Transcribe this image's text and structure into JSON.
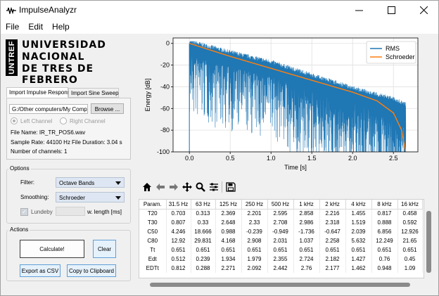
{
  "window": {
    "title": "ImpulseAnalyzr"
  },
  "menu": [
    "File",
    "Edit",
    "Help"
  ],
  "logo": {
    "side": "UNTREF",
    "lines": [
      "UNIVERSIDAD",
      "NACIONAL",
      "DE TRES DE FEBRERO"
    ]
  },
  "tabs": [
    "Import Impulse Response",
    "Import Sine Sweep"
  ],
  "import": {
    "path_value": "G:/Other computers/My Comp",
    "browse_label": "Browse ...",
    "left_channel": "Left Channel",
    "right_channel": "Right Channel",
    "file_name": "File Name: IR_TR_POS6.wav",
    "sample_rate": "Sample Rate: 44100 Hz",
    "duration": "File Duration: 3.04 s",
    "channels": "Number of channels: 1"
  },
  "options": {
    "title": "Options",
    "filter_label": "Filter:",
    "filter_value": "Octave Bands",
    "smoothing_label": "Smoothing:",
    "smoothing_value": "Schroeder",
    "lundeby_label": "Lundeby",
    "lundeby_checked": true,
    "wlength_label": "w. length [ms]"
  },
  "actions": {
    "title": "Actions",
    "calculate": "Calculate!",
    "clear": "Clear",
    "export_csv": "Export as CSV",
    "copy_clipboard": "Copy to Clipboard"
  },
  "chart_data": {
    "type": "line",
    "xlabel": "Time [s]",
    "ylabel": "Energy [dB]",
    "xlim": [
      -0.2,
      2.8
    ],
    "ylim": [
      -100,
      5
    ],
    "xticks": [
      "0.0",
      "0.5",
      "1.0",
      "1.5",
      "2.0",
      "2.5"
    ],
    "yticks": [
      "0",
      "-20",
      "-40",
      "-60",
      "-80",
      "-100"
    ],
    "grid": true,
    "legend_position": "top-right",
    "series": [
      {
        "name": "RMS",
        "color": "#1f77b4",
        "x": [
          0.0,
          0.5,
          1.0,
          1.5,
          2.0,
          2.5,
          2.65
        ],
        "y_upper": [
          0,
          -10,
          -19,
          -31,
          -43,
          -53,
          -58
        ],
        "y_floor": -100
      },
      {
        "name": "Schroeder",
        "color": "#ff7f0e",
        "x": [
          0.0,
          0.5,
          1.0,
          1.5,
          2.0,
          2.3,
          2.5,
          2.6,
          2.65
        ],
        "y": [
          0,
          -12,
          -23,
          -34,
          -45,
          -53,
          -64,
          -80,
          -100
        ]
      }
    ]
  },
  "toolbar": [
    "home-icon",
    "back-icon",
    "forward-icon",
    "pan-icon",
    "zoom-icon",
    "configure-icon",
    "save-icon"
  ],
  "table": {
    "headers": [
      "Param.",
      "31.5 Hz",
      "63 Hz",
      "125 Hz",
      "250 Hz",
      "500 Hz",
      "1 kHz",
      "2 kHz",
      "4 kHz",
      "8 kHz",
      "16 kHz"
    ],
    "rows": [
      [
        "T20",
        "0.703",
        "0.313",
        "2.369",
        "2.201",
        "2.595",
        "2.858",
        "2.216",
        "1.455",
        "0.817",
        "0.458"
      ],
      [
        "T30",
        "0.807",
        "0.33",
        "2.648",
        "2.33",
        "2.708",
        "2.986",
        "2.318",
        "1.519",
        "0.888",
        "0.592"
      ],
      [
        "C50",
        "4.246",
        "18.666",
        "0.988",
        "-0.239",
        "-0.949",
        "-1.736",
        "-0.647",
        "2.039",
        "6.856",
        "12.926"
      ],
      [
        "C80",
        "12.92",
        "29.831",
        "4.168",
        "2.908",
        "2.031",
        "1.037",
        "2.258",
        "5.632",
        "12.249",
        "21.65"
      ],
      [
        "Tt",
        "0.651",
        "0.651",
        "0.651",
        "0.651",
        "0.651",
        "0.651",
        "0.651",
        "0.651",
        "0.651",
        "0.651"
      ],
      [
        "Edt",
        "0.512",
        "0.239",
        "1.934",
        "1.979",
        "2.355",
        "2.724",
        "2.182",
        "1.427",
        "0.76",
        "0.45"
      ],
      [
        "EDTt",
        "0.812",
        "0.288",
        "2.271",
        "2.092",
        "2.442",
        "2.76",
        "2.177",
        "1.462",
        "0.948",
        "1.09"
      ]
    ]
  }
}
